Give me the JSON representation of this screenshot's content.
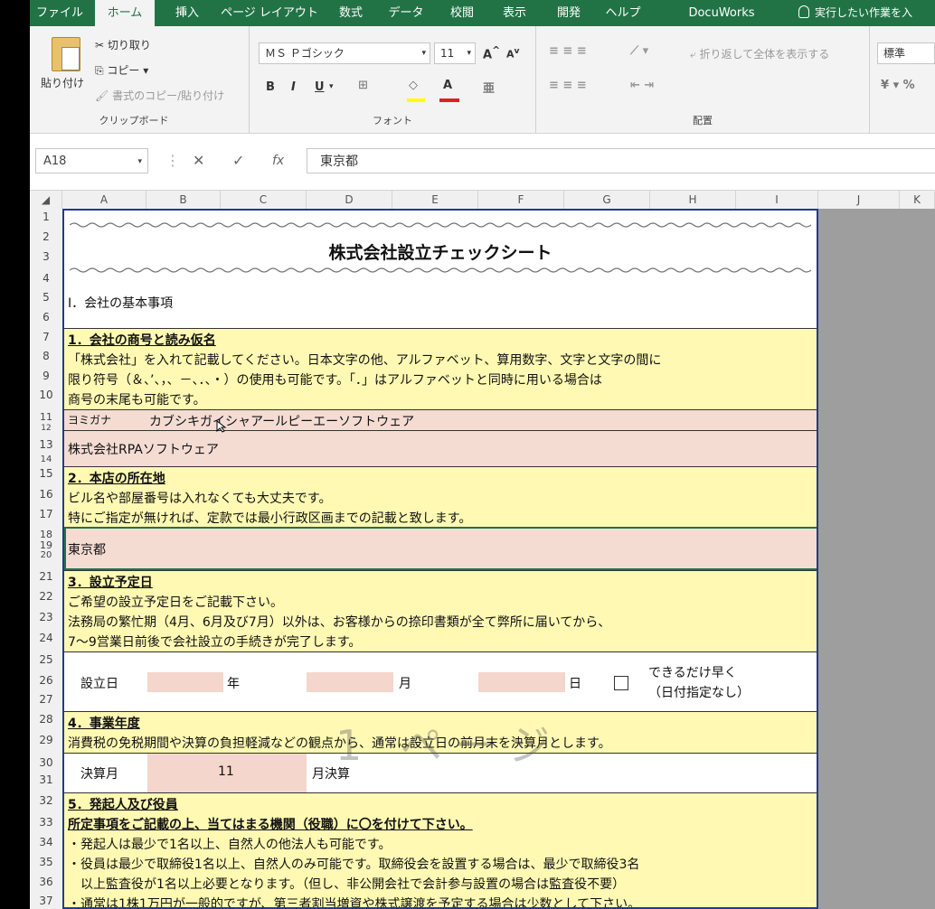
{
  "tabs": [
    "ファイル",
    "ホーム",
    "挿入",
    "ページ レイアウト",
    "数式",
    "データ",
    "校閲",
    "表示",
    "開発",
    "ヘルプ",
    "DocuWorks",
    "実行したい作業を入"
  ],
  "ribbon": {
    "paste": "貼り付け",
    "cut": "切り取り",
    "copy": "コピー",
    "format_painter": "書式のコピー/貼り付け",
    "clipboard_label": "クリップボード",
    "font_name": "ＭＳ Ｐゴシック",
    "font_size": "11",
    "bold": "B",
    "italic": "I",
    "underline": "U",
    "font_label": "フォント",
    "wrap_text": "折り返して全体を表示する",
    "alignment_label": "配置",
    "number_format": "標準"
  },
  "formula_bar": {
    "name_box": "A18",
    "cancel": "✕",
    "enter": "✓",
    "fx": "fx",
    "content": "東京都"
  },
  "columns": [
    "A",
    "B",
    "C",
    "D",
    "E",
    "F",
    "G",
    "H",
    "I",
    "J",
    "K"
  ],
  "rows": [
    "1",
    "2",
    "3",
    "4",
    "5",
    "6",
    "7",
    "8",
    "9",
    "10",
    "11",
    "12",
    "13",
    "14",
    "15",
    "16",
    "17",
    "18",
    "19",
    "20",
    "21",
    "22",
    "23",
    "24",
    "25",
    "26",
    "27",
    "28",
    "29",
    "30",
    "31",
    "32",
    "33",
    "34",
    "35",
    "36",
    "37"
  ],
  "sheet": {
    "title": "株式会社設立チェックシート",
    "section_main": "Ⅰ．会社の基本事項",
    "s1_heading": "1．会社の商号と読み仮名",
    "s1_line1": "「株式会社」を入れて記載してください。日本文字の他、アルファベット、算用数字、文字と文字の間に",
    "s1_line2": "限り符号（＆、’、，、－、．、・）の使用も可能です。「．」はアルファベットと同時に用いる場合は",
    "s1_line3": "商号の末尾も可能です。",
    "yomigana_label": "ヨミガナ",
    "yomigana_value": "カブシキガイシャアールピーエーソフトウェア",
    "company_name": "株式会社RPAソフトウェア",
    "s2_heading": "2．本店の所在地",
    "s2_line1": "ビル名や部屋番号は入れなくても大丈夫です。",
    "s2_line2": "特にご指定が無ければ、定款では最小行政区画までの記載と致します。",
    "address_value": "東京都",
    "s3_heading": "3．設立予定日",
    "s3_line1": "ご希望の設立予定日をご記載下さい。",
    "s3_line2": "法務局の繁忙期（4月、6月及び7月）以外は、お客様からの捺印書類が全て弊所に届いてから、",
    "s3_line3": "7～9営業日前後で会社設立の手続きが完了します。",
    "est_label": "設立日",
    "year_label": "年",
    "month_label": "月",
    "day_label": "日",
    "asap_line1": "できるだけ早く",
    "asap_line2": "（日付指定なし）",
    "s4_heading": "4．事業年度",
    "s4_line1": "消費税の免税期間や決算の負担軽減などの観点から、通常は設立日の前月末を決算月とします。",
    "fiscal_label": "決算月",
    "fiscal_value": "11",
    "fiscal_suffix": "月決算",
    "s5_heading": "5．発起人及び役員",
    "s5_sub": "所定事項をご記載の上、当てはまる機関（役職）に〇を付けて下さい。",
    "s5_line1": "・発起人は最少で1名以上、自然人の他法人も可能です。",
    "s5_line2": "・役員は最少で取締役1名以上、自然人のみ可能です。取締役会を設置する場合は、最少で取締役3名",
    "s5_line3": "　以上監査役が1名以上必要となります。（但し、非公開会社で会計参与設置の場合は監査役不要）",
    "s5_line4": "・通常は1株1万円が一般的ですが、第三者割当増資や株式譲渡を予定する場合は少数として下さい。",
    "watermark": "1 ページ"
  },
  "colors": {
    "excel_green": "#217346",
    "yellow_fill": "#fff9b3",
    "pink_fill": "#f4dcd3",
    "page_border": "#1f3a93"
  }
}
